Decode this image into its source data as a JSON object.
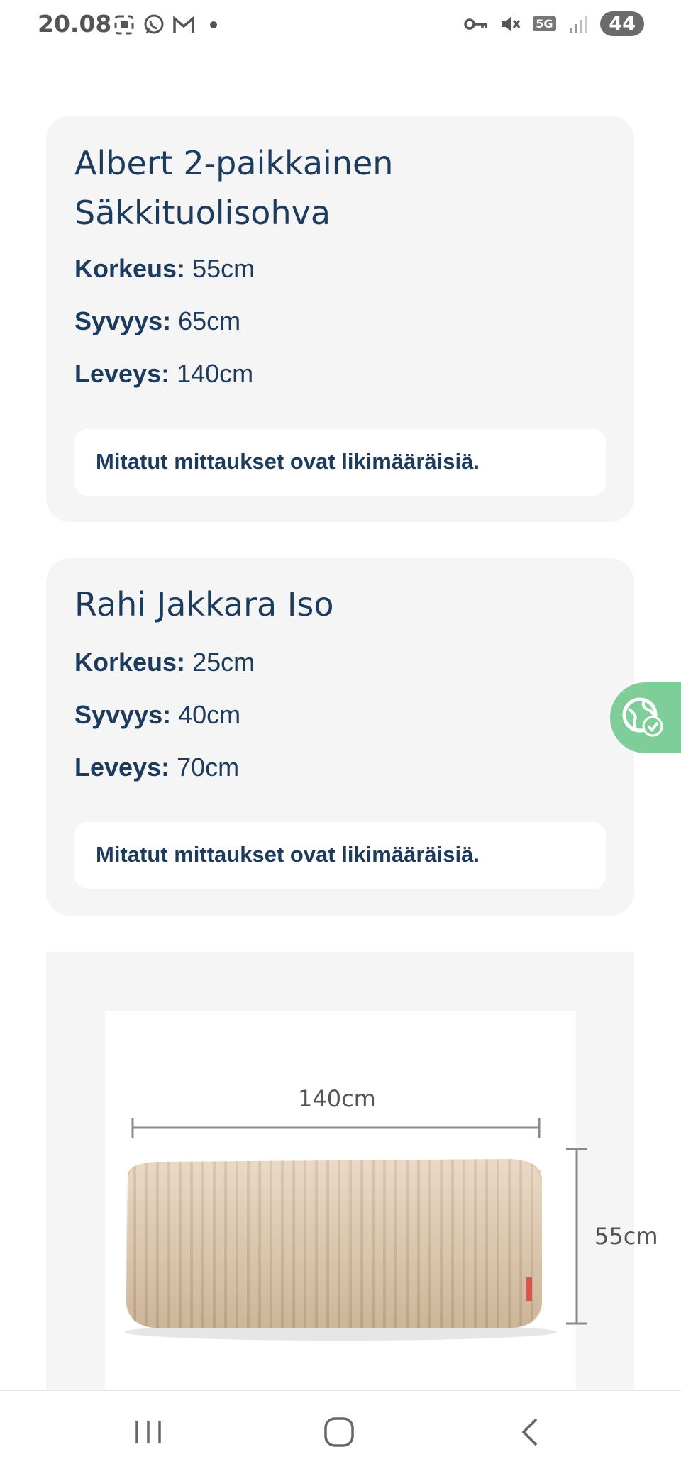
{
  "status_bar": {
    "time": "20.08",
    "left_icons": [
      "screenshot-icon",
      "whatsapp-icon",
      "gmail-icon",
      "dot-icon"
    ],
    "right_icons": [
      "vpn-key-icon",
      "mute-icon",
      "5g-icon",
      "signal-icon"
    ],
    "network_tag": "5G",
    "battery": "44"
  },
  "cards": [
    {
      "title": "Albert 2-paikkainen Säkkituolisohva",
      "specs": [
        {
          "label": "Korkeus:",
          "value": "55cm"
        },
        {
          "label": "Syvyys:",
          "value": "65cm"
        },
        {
          "label": "Leveys:",
          "value": "140cm"
        }
      ],
      "note": "Mitatut mittaukset ovat likimääräisiä."
    },
    {
      "title": "Rahi Jakkara Iso",
      "specs": [
        {
          "label": "Korkeus:",
          "value": "25cm"
        },
        {
          "label": "Syvyys:",
          "value": "40cm"
        },
        {
          "label": "Leveys:",
          "value": "70cm"
        }
      ],
      "note": "Mitatut mittaukset ovat likimääräisiä."
    }
  ],
  "product_image": {
    "width_label": "140cm",
    "height_label": "55cm",
    "fabric_color": "#e3cdb3"
  },
  "accessibility_button": {
    "icon": "globe-check-icon",
    "color": "#7fce9a"
  },
  "nav": {
    "icons": [
      "recents-icon",
      "home-icon",
      "back-icon"
    ]
  },
  "colors": {
    "text": "#1d3b5c",
    "card_bg": "#f5f5f5"
  }
}
